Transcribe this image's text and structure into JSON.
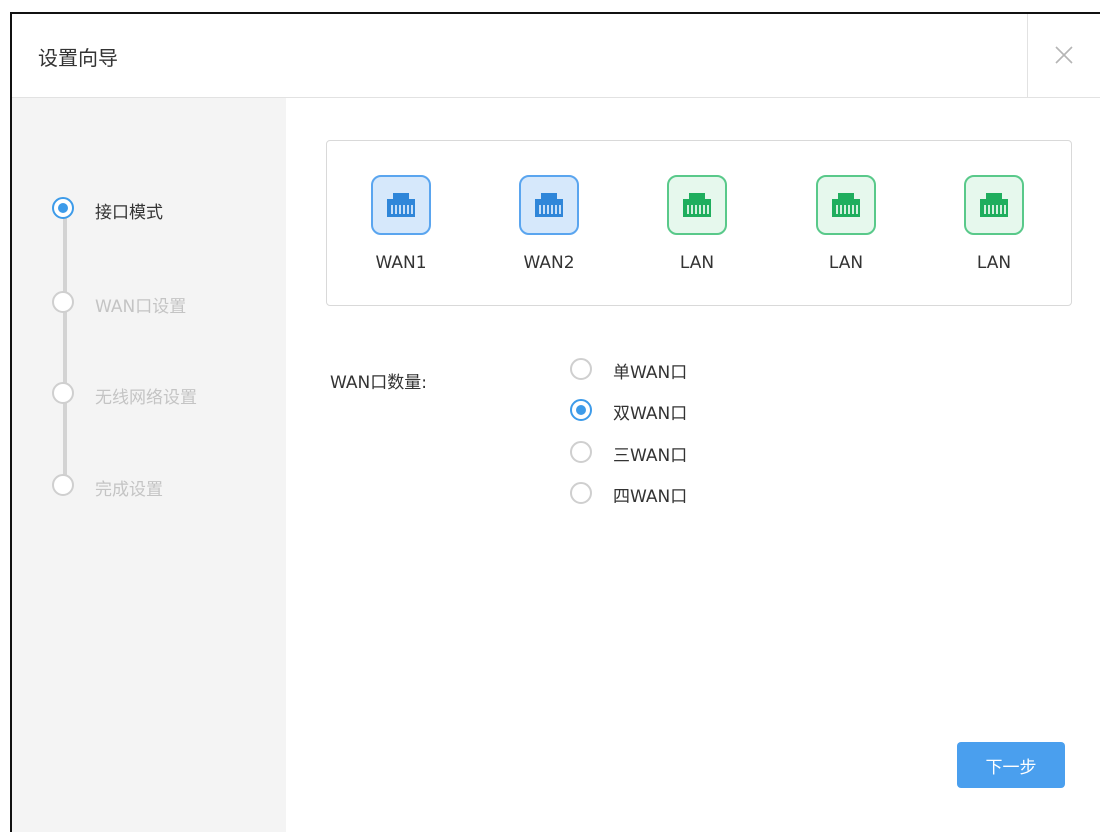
{
  "dialog": {
    "title": "设置向导",
    "close_icon": "close-icon"
  },
  "steps": [
    {
      "label": "接口模式",
      "active": true
    },
    {
      "label": "WAN口设置",
      "active": false
    },
    {
      "label": "无线网络设置",
      "active": false
    },
    {
      "label": "完成设置",
      "active": false
    }
  ],
  "ports": [
    {
      "label": "WAN1",
      "type": "wan",
      "icon": "ethernet-port-icon"
    },
    {
      "label": "WAN2",
      "type": "wan",
      "icon": "ethernet-port-icon"
    },
    {
      "label": "LAN",
      "type": "lan",
      "icon": "ethernet-port-icon"
    },
    {
      "label": "LAN",
      "type": "lan",
      "icon": "ethernet-port-icon"
    },
    {
      "label": "LAN",
      "type": "lan",
      "icon": "ethernet-port-icon"
    }
  ],
  "wan_count": {
    "label": "WAN口数量:",
    "options": [
      {
        "label": "单WAN口",
        "checked": false
      },
      {
        "label": "双WAN口",
        "checked": true
      },
      {
        "label": "三WAN口",
        "checked": false
      },
      {
        "label": "四WAN口",
        "checked": false
      }
    ]
  },
  "footer": {
    "next_label": "下一步"
  },
  "colors": {
    "accent": "#3d9be9",
    "wan_port": "#5aa5ef",
    "lan_port": "#59c98a",
    "sidebar_bg": "#f4f4f4"
  }
}
